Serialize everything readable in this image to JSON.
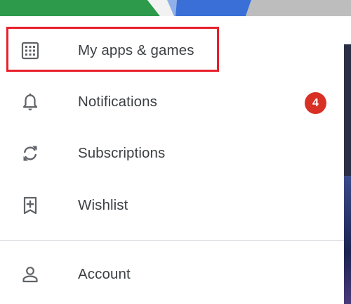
{
  "colors": {
    "highlight": "#e8202b",
    "badge": "#d93025",
    "text": "#3c4043",
    "icon": "#5f6368",
    "divider": "#dadce0"
  },
  "menu": {
    "items": [
      {
        "label": "My apps & games",
        "icon": "grid-icon"
      },
      {
        "label": "Notifications",
        "icon": "bell-icon",
        "badge": "4"
      },
      {
        "label": "Subscriptions",
        "icon": "refresh-icon"
      },
      {
        "label": "Wishlist",
        "icon": "bookmark-add-icon"
      }
    ],
    "secondary": [
      {
        "label": "Account",
        "icon": "person-icon"
      }
    ]
  }
}
